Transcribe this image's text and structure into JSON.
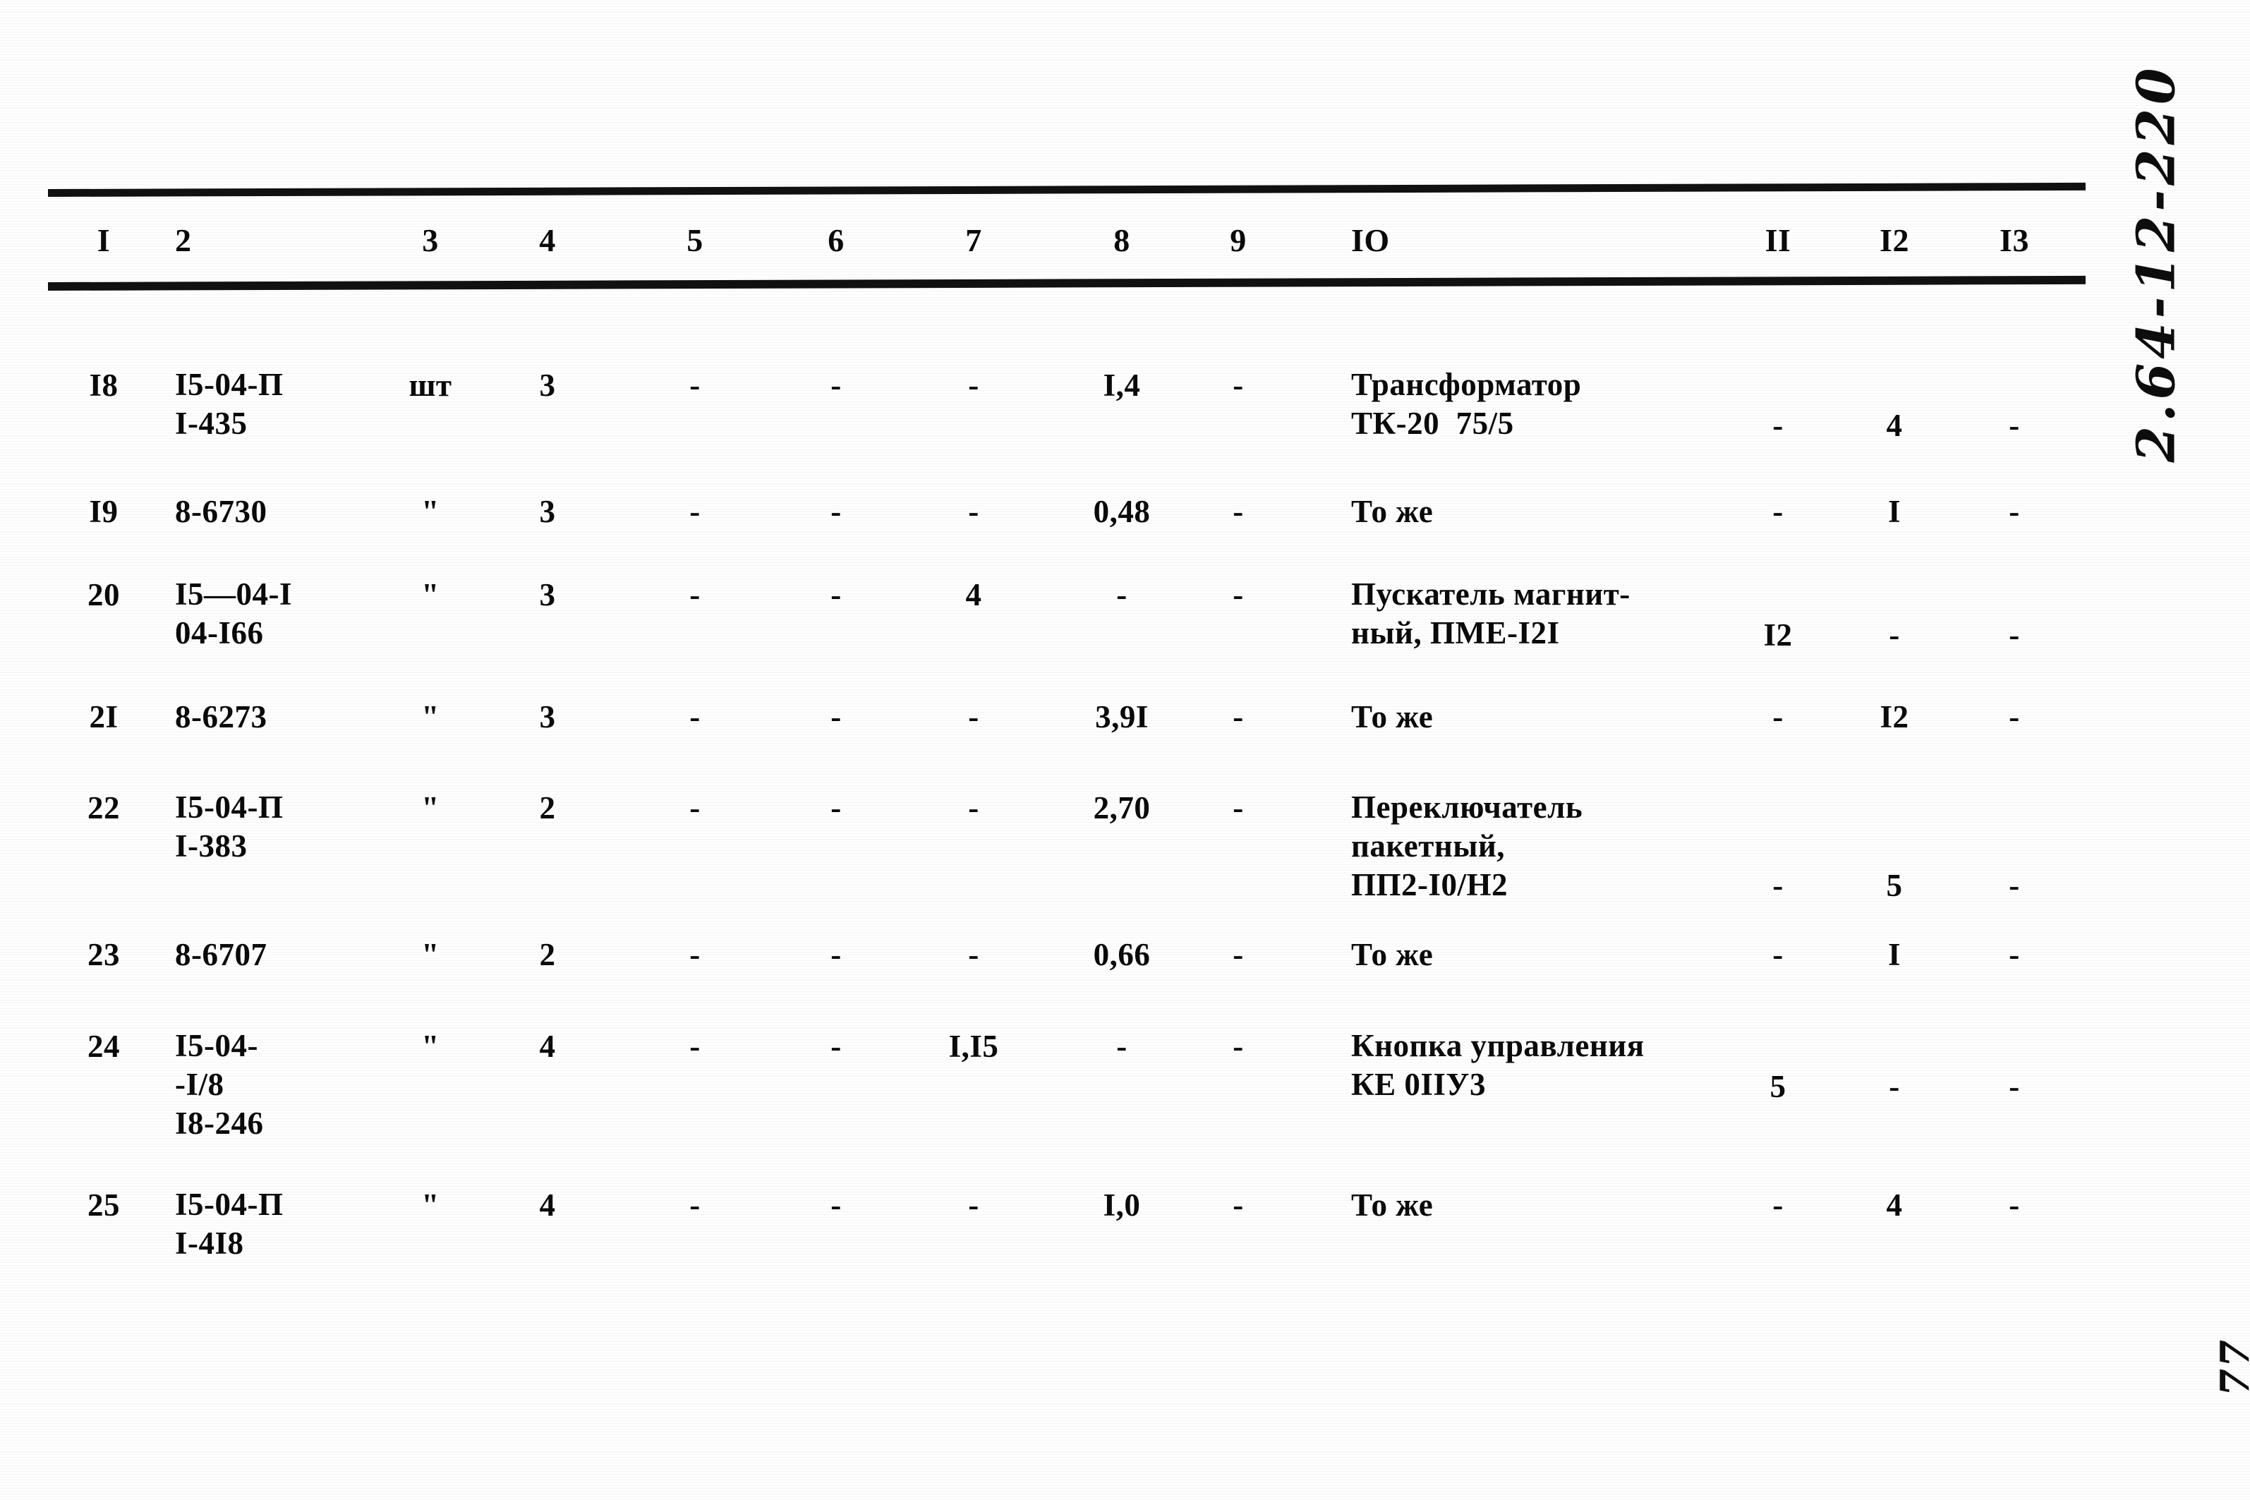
{
  "document": {
    "margin_code": "2.64-12-220",
    "page_number": "77"
  },
  "table": {
    "headers": [
      "I",
      "2",
      "3",
      "4",
      "5",
      "6",
      "7",
      "8",
      "9",
      "IO",
      "II",
      "I2",
      "I3"
    ],
    "rows": [
      {
        "c1": "I8",
        "c2": "I5-04-П\nI-435",
        "c3": "шт",
        "c4": "3",
        "c5": "-",
        "c6": "-",
        "c7": "-",
        "c8": "I,4",
        "c9": "-",
        "c10": "Трансформатор\nТК-20  75/5",
        "c11": "-",
        "c12": "4",
        "c13": "-"
      },
      {
        "c1": "I9",
        "c2": "8-6730",
        "c3": "\"",
        "c4": "3",
        "c5": "-",
        "c6": "-",
        "c7": "-",
        "c8": "0,48",
        "c9": "-",
        "c10": "То же",
        "c11": "-",
        "c12": "I",
        "c13": "-"
      },
      {
        "c1": "20",
        "c2": "I5—04-I\n04-I66",
        "c3": "\"",
        "c4": "3",
        "c5": "-",
        "c6": "-",
        "c7": "4",
        "c8": "-",
        "c9": "-",
        "c10": "Пускатель магнит-\nный, ПМЕ-I2I",
        "c11": "I2",
        "c12": "-",
        "c13": "-"
      },
      {
        "c1": "2I",
        "c2": "8-6273",
        "c3": "\"",
        "c4": "3",
        "c5": "-",
        "c6": "-",
        "c7": "-",
        "c8": "3,9I",
        "c9": "-",
        "c10": "То же",
        "c11": "-",
        "c12": "I2",
        "c13": "-"
      },
      {
        "c1": "22",
        "c2": "I5-04-П\nI-383",
        "c3": "\"",
        "c4": "2",
        "c5": "-",
        "c6": "-",
        "c7": "-",
        "c8": "2,70",
        "c9": "-",
        "c10": "Переключатель\nпакетный,\nПП2-I0/Н2",
        "c11": "-",
        "c12": "5",
        "c13": "-"
      },
      {
        "c1": "23",
        "c2": "8-6707",
        "c3": "\"",
        "c4": "2",
        "c5": "-",
        "c6": "-",
        "c7": "-",
        "c8": "0,66",
        "c9": "-",
        "c10": "То же",
        "c11": "-",
        "c12": "I",
        "c13": "-"
      },
      {
        "c1": "24",
        "c2": "I5-04-\n-I/8\nI8-246",
        "c3": "\"",
        "c4": "4",
        "c5": "-",
        "c6": "-",
        "c7": "I,I5",
        "c8": "-",
        "c9": "-",
        "c10": "Кнопка управления\nКЕ 0IIУ3",
        "c11": "5",
        "c12": "-",
        "c13": "-"
      },
      {
        "c1": "25",
        "c2": "I5-04-П\nI-4I8",
        "c3": "\"",
        "c4": "4",
        "c5": "-",
        "c6": "-",
        "c7": "-",
        "c8": "I,0",
        "c9": "-",
        "c10": "То же",
        "c11": "-",
        "c12": "4",
        "c13": "-"
      }
    ]
  }
}
